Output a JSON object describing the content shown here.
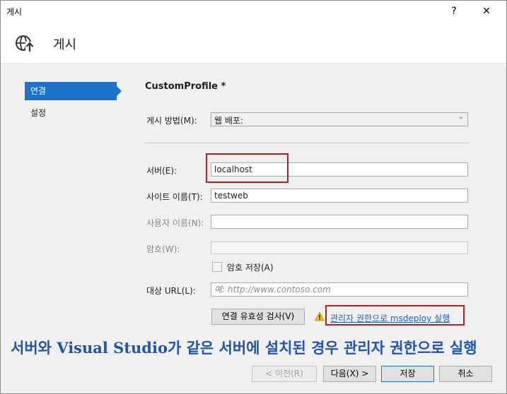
{
  "window": {
    "title": "게시",
    "help": "?",
    "close": "✕"
  },
  "header": {
    "title": "게시"
  },
  "nav": [
    {
      "label": "연결"
    },
    {
      "label": "설정"
    }
  ],
  "profile": "CustomProfile *",
  "form": {
    "method_label": "게시 방법(M):",
    "method_value": "웹 배포:",
    "server_label": "서버(E):",
    "server_value": "localhost",
    "site_label": "사이트 이름(T):",
    "site_value": "testweb",
    "user_label": "사용자 이름(N):",
    "user_value": "",
    "password_label": "암호(W):",
    "password_value": "",
    "save_password_label": "암호 저장(A)",
    "url_label": "대상 URL(L):",
    "url_placeholder": "예: http://www.contoso.com"
  },
  "validate_button": "연결 유효성 검사(V)",
  "admin_link": "관리자 권한으로 msdeploy 실행",
  "buttons": {
    "prev": "< 이전(R)",
    "next": "다음(X) >",
    "save": "저장",
    "cancel": "취소"
  },
  "annotation": "서버와 Visual Studio가 같은 서버에 설치된 경우 관리자 권한으로 실행",
  "colors": {
    "accent": "#1e73c8",
    "highlight": "#b22222",
    "annotation": "#2154ad"
  }
}
